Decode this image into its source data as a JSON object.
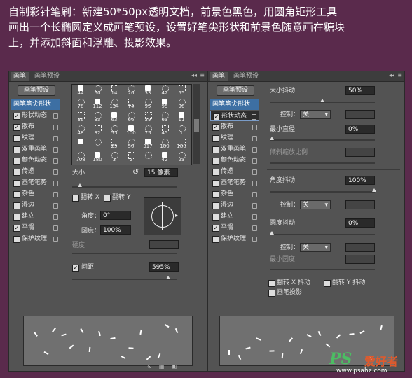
{
  "caption": {
    "line1": "自制彩针笔刷：新建50*50px透明文档，前景色黑色，用圆角矩形工具",
    "line2": "画出一个长椭圆定义成画笔预设，设置好笔尖形状和前景色随意画在糖块",
    "line3": "上，并添加斜面和浮雕、投影效果。"
  },
  "left": {
    "tabs": [
      "画笔",
      "画笔预设"
    ],
    "preset_button": "画笔预设",
    "list": [
      {
        "label": "画笔笔尖形状",
        "checked": false,
        "header": true
      },
      {
        "label": "形状动态",
        "checked": true
      },
      {
        "label": "散布",
        "checked": true
      },
      {
        "label": "纹理",
        "checked": false
      },
      {
        "label": "双重画笔",
        "checked": false
      },
      {
        "label": "颜色动态",
        "checked": false
      },
      {
        "label": "传递",
        "checked": false
      },
      {
        "label": "画笔笔势",
        "checked": false
      },
      {
        "label": "杂色",
        "checked": false
      },
      {
        "label": "湿边",
        "checked": false
      },
      {
        "label": "建立",
        "checked": false
      },
      {
        "label": "平滑",
        "checked": true
      },
      {
        "label": "保护纹理",
        "checked": false
      }
    ],
    "brush_rows": [
      [
        "44",
        "60",
        "14",
        "26",
        "33",
        "42",
        "55"
      ],
      [
        "70",
        "112",
        "134",
        "74",
        "95",
        "95",
        "90"
      ],
      [
        "36",
        "33",
        "63",
        "66",
        "39",
        "63",
        "11"
      ],
      [
        "48",
        "32",
        "55",
        "100",
        "75",
        "45",
        "1"
      ],
      [
        "",
        "",
        "25",
        "50",
        "317",
        "180",
        "180"
      ],
      [
        "708",
        "180",
        "3",
        "2",
        "",
        "42",
        "23"
      ]
    ],
    "size_label": "大小",
    "size_value": "15 像素",
    "flip_x": "翻转 X",
    "flip_y": "翻转 Y",
    "angle_label": "角度：",
    "angle_value": "0°",
    "roundness_label": "圆度：",
    "roundness_value": "100%",
    "hardness_label": "硬度",
    "spacing_label": "间距",
    "spacing_value": "595%",
    "spacing_checked": true
  },
  "right": {
    "tabs": [
      "画笔",
      "画笔预设"
    ],
    "preset_button": "画笔预设",
    "list": [
      {
        "label": "画笔笔尖形状",
        "checked": false,
        "header": true
      },
      {
        "label": "形状动态",
        "checked": true,
        "selected": true
      },
      {
        "label": "散布",
        "checked": true
      },
      {
        "label": "纹理",
        "checked": false
      },
      {
        "label": "双重画笔",
        "checked": false
      },
      {
        "label": "颜色动态",
        "checked": false
      },
      {
        "label": "传递",
        "checked": false
      },
      {
        "label": "画笔笔势",
        "checked": false
      },
      {
        "label": "杂色",
        "checked": false
      },
      {
        "label": "湿边",
        "checked": false
      },
      {
        "label": "建立",
        "checked": false
      },
      {
        "label": "平滑",
        "checked": true
      },
      {
        "label": "保护纹理",
        "checked": false
      }
    ],
    "size_jitter_label": "大小抖动",
    "size_jitter_value": "50%",
    "control_label": "控制：",
    "control_value": "关",
    "min_diameter_label": "最小直径",
    "min_diameter_value": "0%",
    "tilt_scale_label": "倾斜缩放比例",
    "angle_jitter_label": "角度抖动",
    "angle_jitter_value": "100%",
    "control2_value": "关",
    "round_jitter_label": "圆度抖动",
    "round_jitter_value": "0%",
    "control3_value": "关",
    "min_roundness_label": "最小圆度",
    "flip_x_jitter": "翻转 X 抖动",
    "flip_y_jitter": "翻转 Y 抖动",
    "brush_projection": "画笔投影"
  },
  "watermark": {
    "ps": "PS",
    "cn": "爱好者",
    "url": "www.psahz.com"
  }
}
